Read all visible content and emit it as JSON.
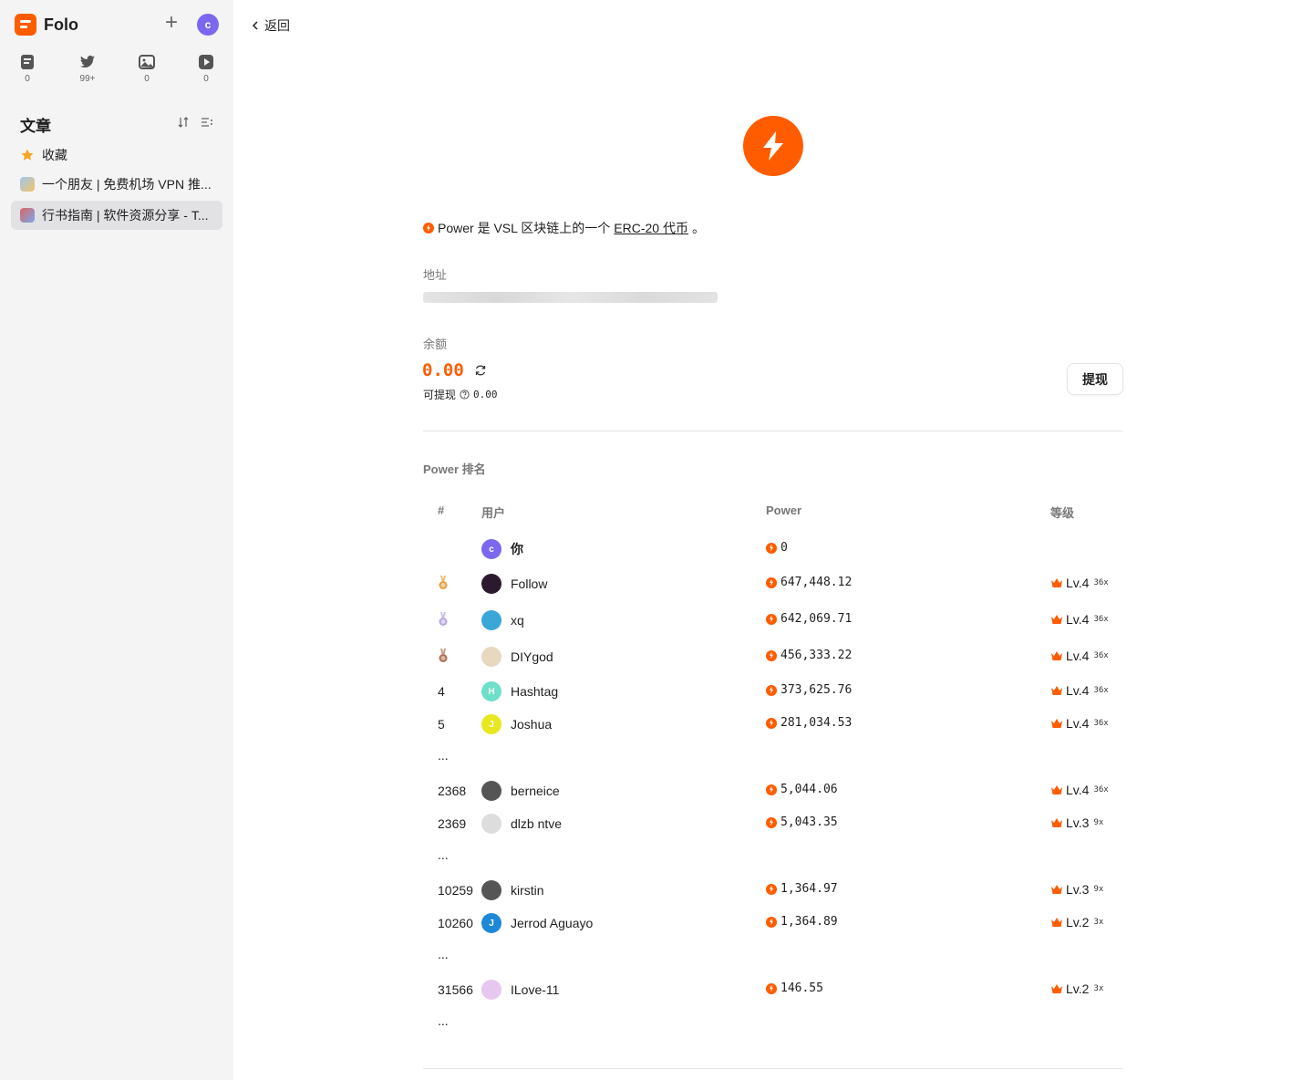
{
  "app": {
    "name": "Folo",
    "avatar_letter": "c"
  },
  "views": [
    {
      "icon": "article-icon",
      "count": "0"
    },
    {
      "icon": "social-icon",
      "count": "99+"
    },
    {
      "icon": "pictures-icon",
      "count": "0"
    },
    {
      "icon": "video-icon",
      "count": "0"
    }
  ],
  "sidebar": {
    "section_title": "文章",
    "feeds": [
      {
        "label": "收藏",
        "icon": "star-icon"
      },
      {
        "label": "一个朋友 | 免费机场 VPN 推...",
        "icon": "feed-favicon"
      },
      {
        "label": "行书指南 | 软件资源分享 - T...",
        "icon": "feed-favicon",
        "active": true
      }
    ]
  },
  "main": {
    "back_label": "返回",
    "desc_prefix": "Power 是 VSL 区块链上的一个 ",
    "desc_link": "ERC-20 代币",
    "desc_suffix": "。",
    "address_label": "地址",
    "balance_label": "余额",
    "balance_value": "0.00",
    "withdrawable_label": "可提现",
    "withdrawable_value": "0.00",
    "withdraw_button": "提现",
    "ranking_title": "Power 排名",
    "columns": {
      "rank": "#",
      "user": "用户",
      "power": "Power",
      "level": "等级"
    }
  },
  "ranking": [
    {
      "rank": "",
      "user": "你",
      "power": "0",
      "level": "",
      "mult": "",
      "avatar_color": "#7b68ee",
      "avatar_letter": "c",
      "bold": true
    },
    {
      "rank": "",
      "medal": "gold",
      "user": "Follow",
      "power": "647,448.12",
      "level": "Lv.4",
      "mult": "36x",
      "avatar_color": "#2b1a2e",
      "avatar_letter": ""
    },
    {
      "rank": "",
      "medal": "silver",
      "user": "xq",
      "power": "642,069.71",
      "level": "Lv.4",
      "mult": "36x",
      "avatar_color": "#3aa7d8",
      "avatar_letter": ""
    },
    {
      "rank": "",
      "medal": "bronze",
      "user": "DIYgod",
      "power": "456,333.22",
      "level": "Lv.4",
      "mult": "36x",
      "avatar_color": "#e8d8c0",
      "avatar_letter": ""
    },
    {
      "rank": "4",
      "user": "Hashtag",
      "power": "373,625.76",
      "level": "Lv.4",
      "mult": "36x",
      "avatar_color": "#6ee0c8",
      "avatar_letter": "H"
    },
    {
      "rank": "5",
      "user": "Joshua",
      "power": "281,034.53",
      "level": "Lv.4",
      "mult": "36x",
      "avatar_color": "#e8e820",
      "avatar_letter": "J"
    },
    {
      "ellipsis": "..."
    },
    {
      "rank": "2368",
      "user": "berneice",
      "power": "5,044.06",
      "level": "Lv.4",
      "mult": "36x",
      "avatar_color": "#555555",
      "avatar_letter": ""
    },
    {
      "rank": "2369",
      "user": "dlzb ntve",
      "power": "5,043.35",
      "level": "Lv.3",
      "mult": "9x",
      "avatar_color": "#dddddd",
      "avatar_letter": ""
    },
    {
      "ellipsis": "..."
    },
    {
      "rank": "10259",
      "user": "kirstin",
      "power": "1,364.97",
      "level": "Lv.3",
      "mult": "9x",
      "avatar_color": "#555555",
      "avatar_letter": ""
    },
    {
      "rank": "10260",
      "user": "Jerrod Aguayo",
      "power": "1,364.89",
      "level": "Lv.2",
      "mult": "3x",
      "avatar_color": "#1e88d8",
      "avatar_letter": "J"
    },
    {
      "ellipsis": "..."
    },
    {
      "rank": "31566",
      "user": "ILove-11",
      "power": "146.55",
      "level": "Lv.2",
      "mult": "3x",
      "avatar_color": "#e7c7f0",
      "avatar_letter": ""
    },
    {
      "ellipsis": "..."
    }
  ],
  "colors": {
    "accent": "#ff5c00",
    "sidebar_bg": "#f4f4f5",
    "active_bg": "#e2e2e5"
  }
}
